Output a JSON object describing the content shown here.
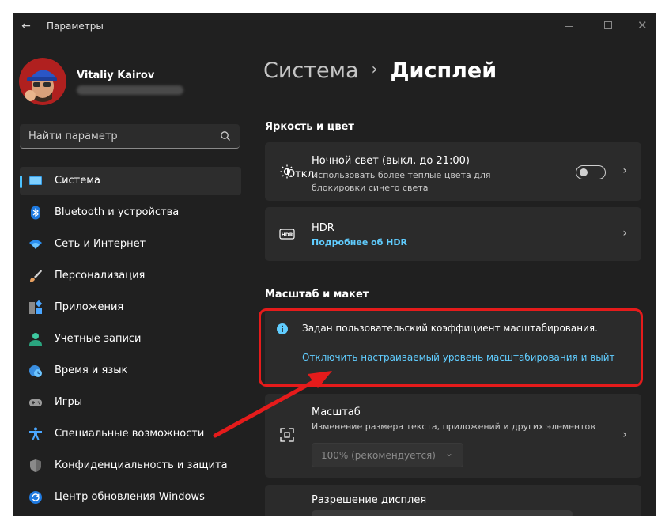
{
  "window": {
    "title": "Параметры"
  },
  "user": {
    "name": "Vitaliy Kairov"
  },
  "search": {
    "placeholder": "Найти параметр"
  },
  "sidebar": {
    "items": [
      {
        "label": "Система",
        "icon": "monitor-icon",
        "active": true
      },
      {
        "label": "Bluetooth и устройства",
        "icon": "bluetooth-icon"
      },
      {
        "label": "Сеть и Интернет",
        "icon": "wifi-icon"
      },
      {
        "label": "Персонализация",
        "icon": "brush-icon"
      },
      {
        "label": "Приложения",
        "icon": "apps-icon"
      },
      {
        "label": "Учетные записи",
        "icon": "person-icon"
      },
      {
        "label": "Время и язык",
        "icon": "globe-clock-icon"
      },
      {
        "label": "Игры",
        "icon": "gamepad-icon"
      },
      {
        "label": "Специальные возможности",
        "icon": "accessibility-icon"
      },
      {
        "label": "Конфиденциальность и защита",
        "icon": "shield-icon"
      },
      {
        "label": "Центр обновления Windows",
        "icon": "update-icon"
      }
    ]
  },
  "breadcrumb": {
    "parent": "Система",
    "separator": "›",
    "current": "Дисплей"
  },
  "sections": {
    "brightness": {
      "heading": "Яркость и цвет",
      "night_light": {
        "title": "Ночной свет (выкл. до 21:00)",
        "subtitle": "Использовать более теплые цвета для блокировки синего света",
        "toggle_label": "Откл."
      },
      "hdr": {
        "title": "HDR",
        "link": "Подробнее об HDR"
      }
    },
    "scale_layout": {
      "heading": "Масштаб и макет",
      "notice_text": "Задан пользовательский коэффициент масштабирования.",
      "notice_link": "Отключить настраиваемый уровень масштабирования и выйт",
      "scale": {
        "title": "Масштаб",
        "subtitle": "Изменение размера текста, приложений и других элементов",
        "dropdown_value": "100% (рекомендуется)"
      },
      "resolution": {
        "title": "Разрешение дисплея"
      }
    }
  },
  "colors": {
    "accent": "#4cc2ff",
    "link": "#60cdff",
    "annotation": "#e51b1b",
    "background": "#202020",
    "card": "#2b2b2b"
  }
}
